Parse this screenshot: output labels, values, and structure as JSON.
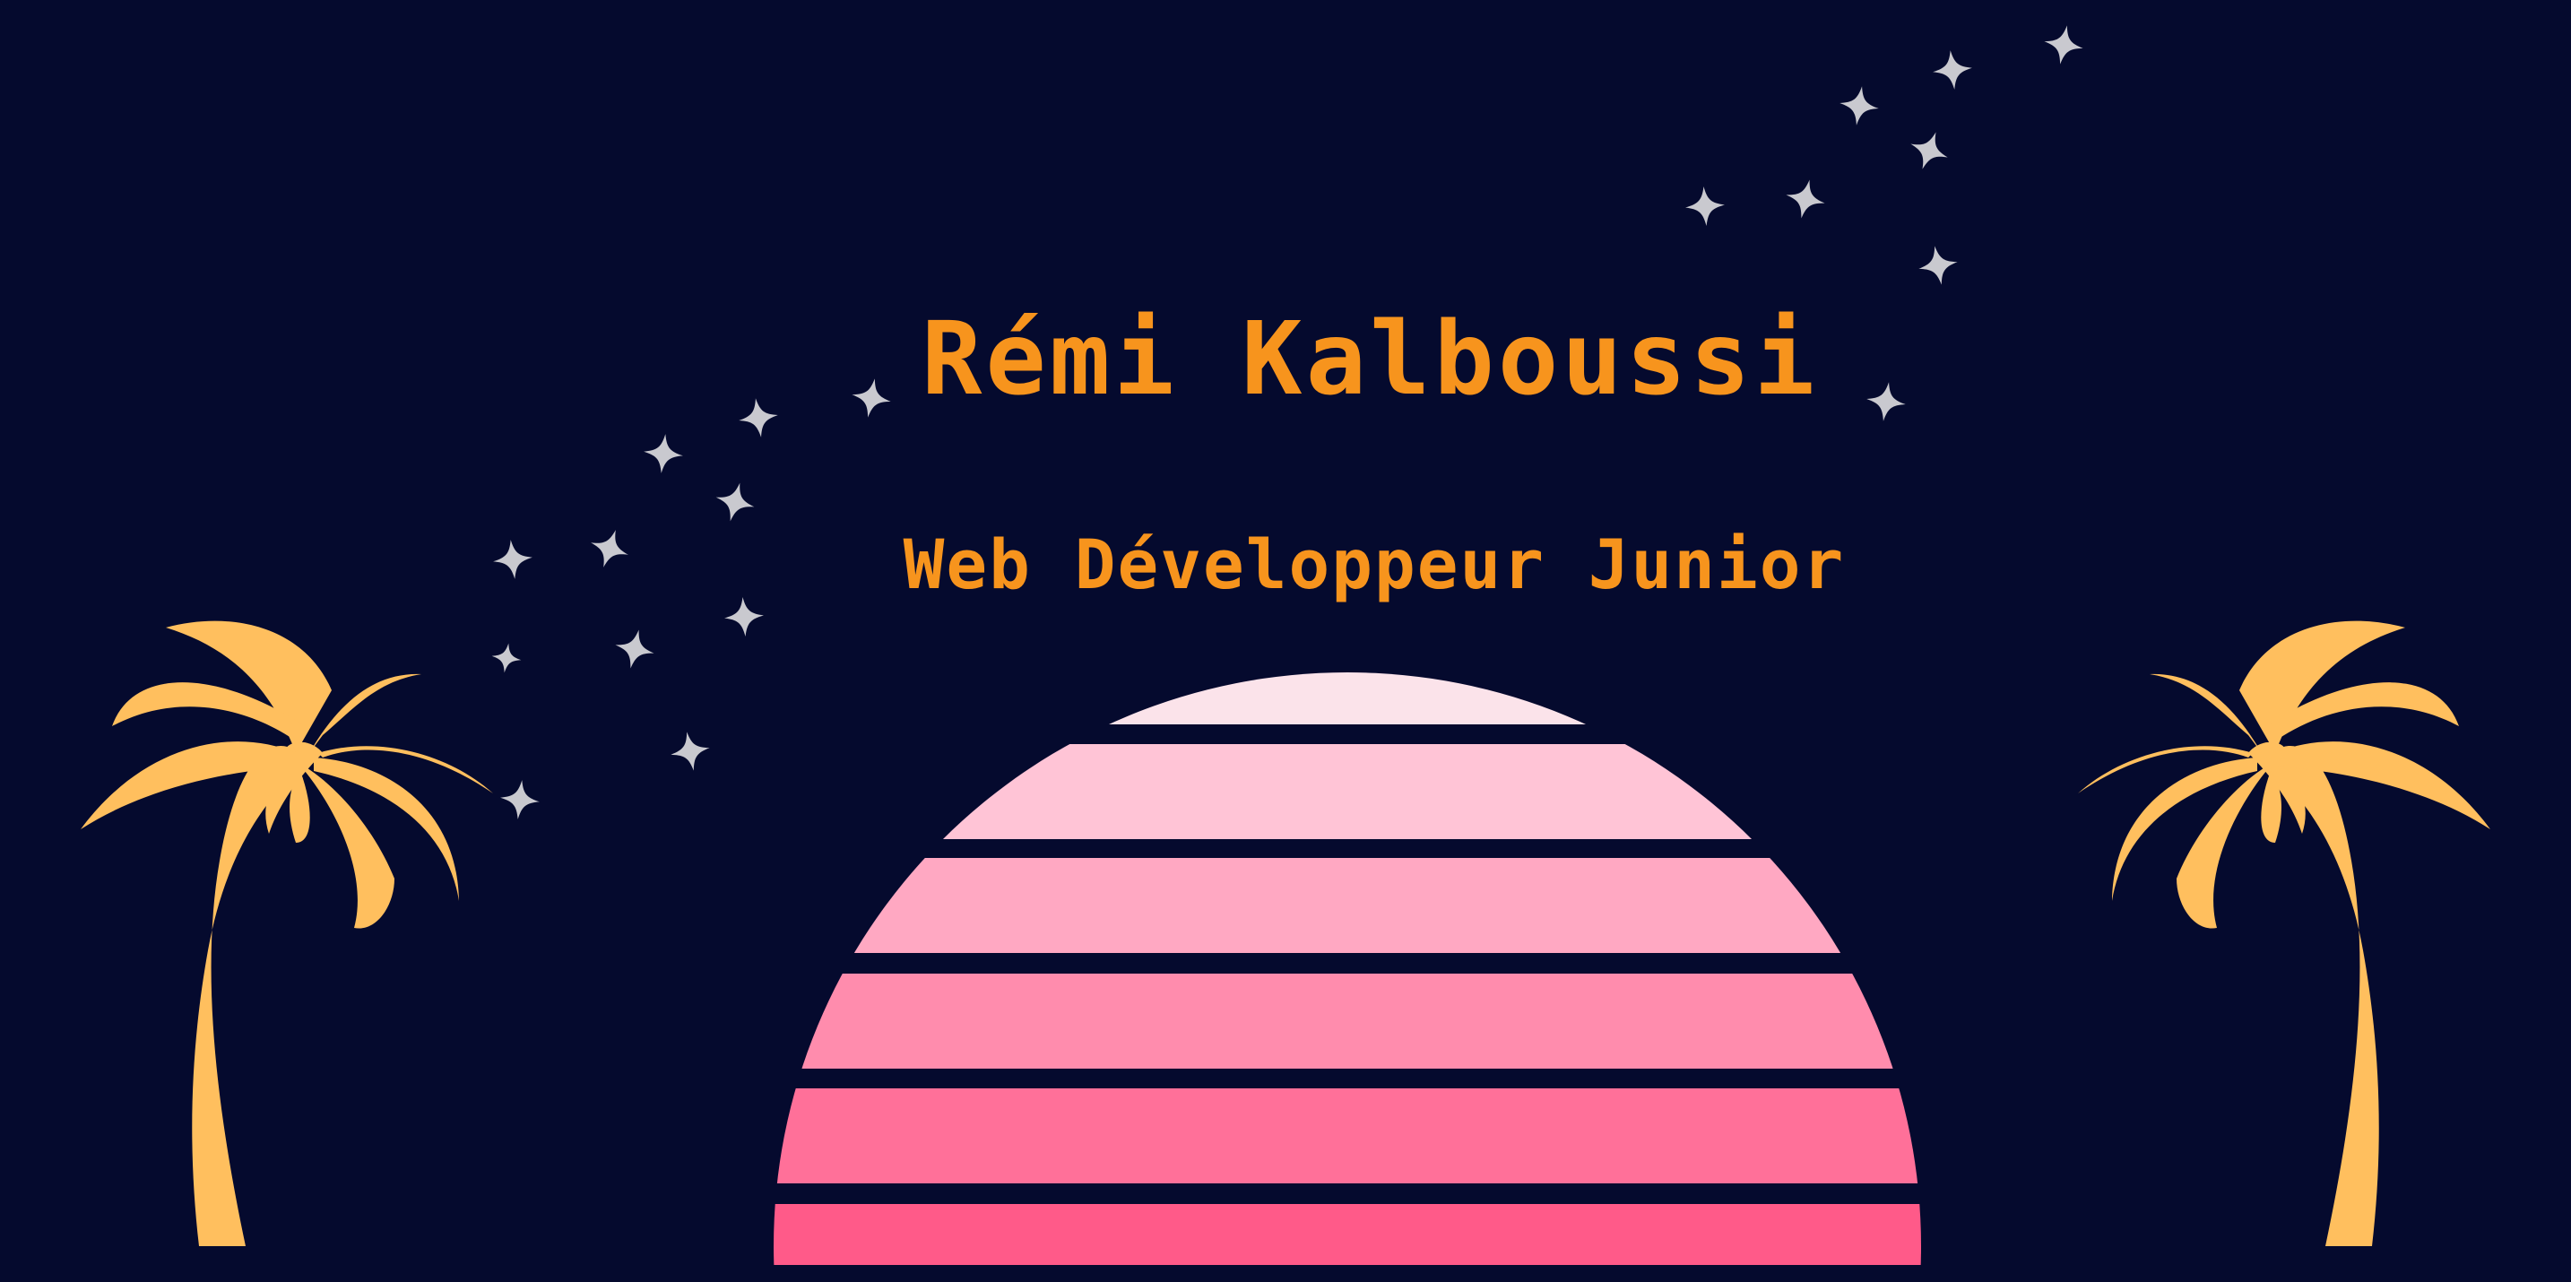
{
  "hero": {
    "name": "Rémi Kalboussi",
    "role": "Web Développeur Junior"
  },
  "colors": {
    "background": "#050a2e",
    "text_accent": "#f7941d",
    "palm": "#ffbf5e",
    "star": "#c9c9cf",
    "sun_bands": [
      "#fbe3ea",
      "#ffc4d6",
      "#ffa8c2",
      "#ff8cad",
      "#ff7099",
      "#ff5a89"
    ]
  },
  "icons": {
    "left_palm": "palm-tree-icon",
    "right_palm": "palm-tree-icon",
    "stars": "sparkle-star-icon",
    "sun": "striped-sunset-sun-icon"
  }
}
